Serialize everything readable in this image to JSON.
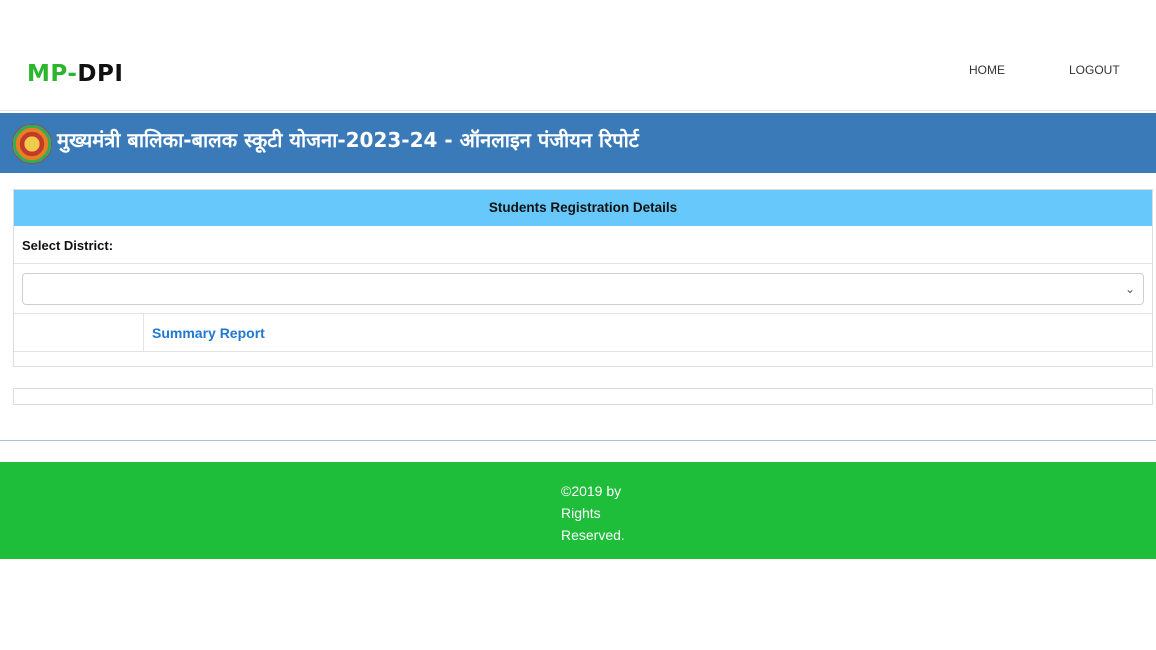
{
  "header": {
    "brand_prefix": "MP-",
    "brand_suffix": "DPI",
    "nav": {
      "home": "HOME",
      "logout": "LOGOUT"
    }
  },
  "banner": {
    "title": "मुख्यमंत्री बालिका-बालक स्कूटी योजना-2023-24 - ऑनलाइन पंजीयन रिपोर्ट",
    "emblem_icon": "mp-government-emblem-icon"
  },
  "panel": {
    "heading": "Students Registration Details",
    "district_label": "Select District:",
    "district_select": {
      "selected": ""
    },
    "summary_link": "Summary Report"
  },
  "footer": {
    "copyright": "©2019 by Rights Reserved."
  },
  "colors": {
    "brand_green": "#2db52d",
    "banner_blue": "#3a7ab8",
    "panel_head": "#67c8fb",
    "link_blue": "#1f78d1",
    "footer_green": "#1ebd3a"
  }
}
